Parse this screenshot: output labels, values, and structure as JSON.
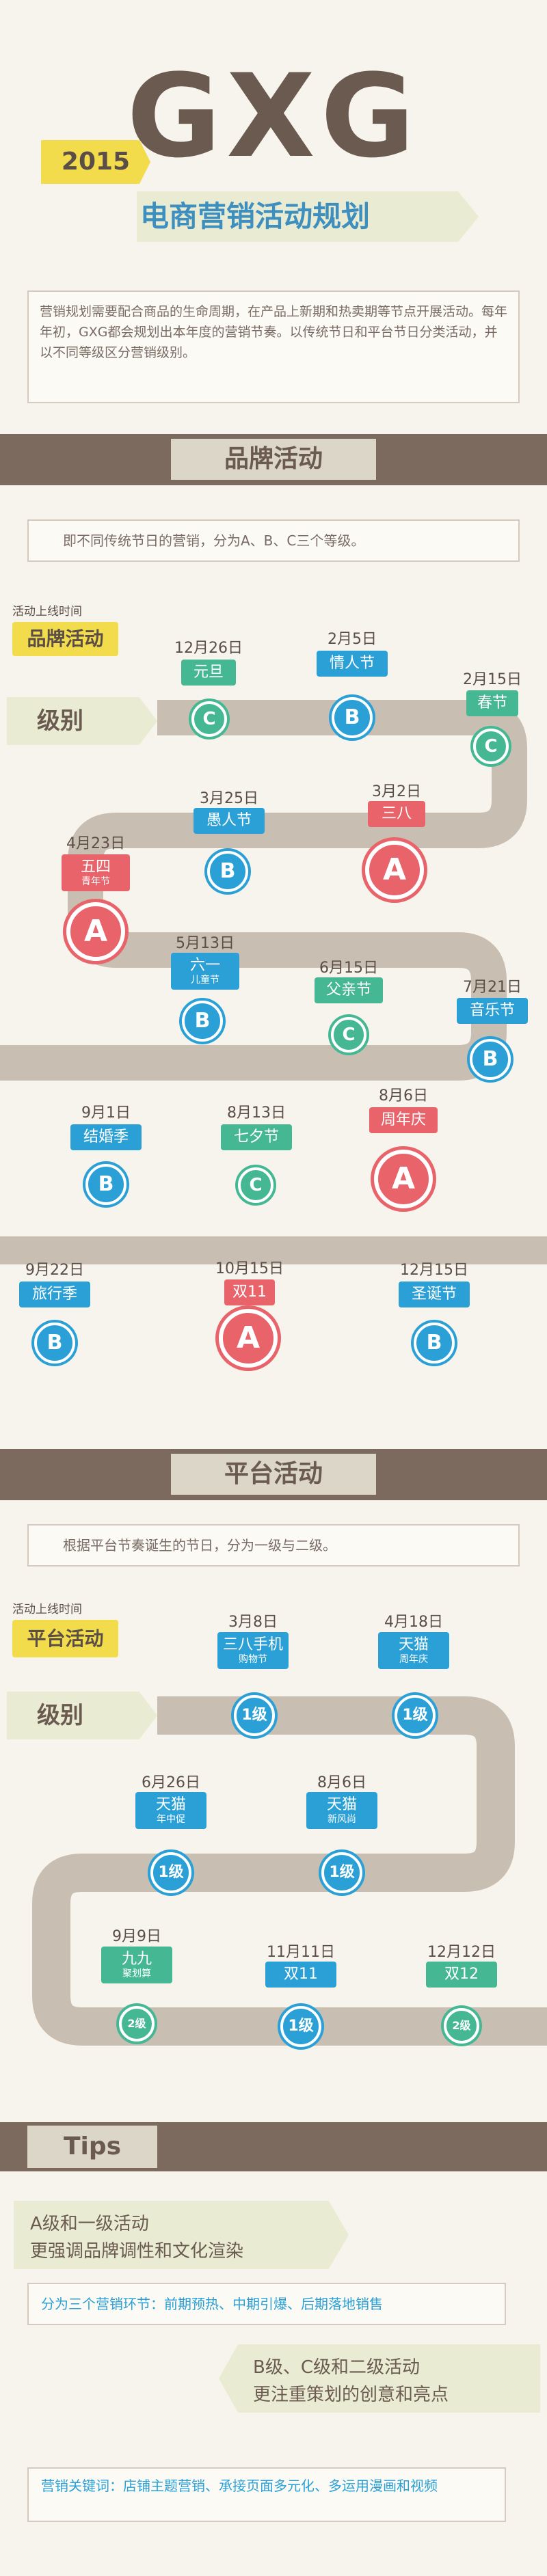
{
  "header": {
    "logo": "GXG",
    "year": "2015",
    "title": "电商营销活动规划",
    "intro": "营销规划需要配合商品的生命周期，在产品上新期和热卖期等节点开展活动。每年年初，GXG都会规划出本年度的营销节奏。以传统节日和平台节日分类活动，并以不同等级区分营销级别。"
  },
  "brand": {
    "section_title": "品牌活动",
    "note": "即不同传统节日的营销，分为A、B、C三个等级。",
    "online_time_label": "活动上线时间",
    "flag": "品牌活动",
    "level_label": "级别",
    "events": [
      {
        "date": "12月26日",
        "name": "元旦",
        "sub": "",
        "grade": "C",
        "color": "green"
      },
      {
        "date": "2月5日",
        "name": "情人节",
        "sub": "",
        "grade": "B",
        "color": "blue"
      },
      {
        "date": "2月15日",
        "name": "春节",
        "sub": "",
        "grade": "C",
        "color": "green"
      },
      {
        "date": "3月25日",
        "name": "愚人节",
        "sub": "",
        "grade": "B",
        "color": "blue"
      },
      {
        "date": "3月2日",
        "name": "三八",
        "sub": "",
        "grade": "A",
        "color": "red"
      },
      {
        "date": "4月23日",
        "name": "五四",
        "sub": "青年节",
        "grade": "A",
        "color": "red"
      },
      {
        "date": "5月13日",
        "name": "六一",
        "sub": "儿童节",
        "grade": "B",
        "color": "blue"
      },
      {
        "date": "6月15日",
        "name": "父亲节",
        "sub": "",
        "grade": "C",
        "color": "green"
      },
      {
        "date": "7月21日",
        "name": "音乐节",
        "sub": "",
        "grade": "B",
        "color": "blue"
      },
      {
        "date": "9月1日",
        "name": "结婚季",
        "sub": "",
        "grade": "B",
        "color": "blue"
      },
      {
        "date": "8月13日",
        "name": "七夕节",
        "sub": "",
        "grade": "C",
        "color": "green"
      },
      {
        "date": "8月6日",
        "name": "周年庆",
        "sub": "",
        "grade": "A",
        "color": "red"
      },
      {
        "date": "9月22日",
        "name": "旅行季",
        "sub": "",
        "grade": "B",
        "color": "blue"
      },
      {
        "date": "10月15日",
        "name": "双11",
        "sub": "",
        "grade": "A",
        "color": "red"
      },
      {
        "date": "12月15日",
        "name": "圣诞节",
        "sub": "",
        "grade": "B",
        "color": "blue"
      }
    ]
  },
  "platform": {
    "section_title": "平台活动",
    "note": "根据平台节奏诞生的节日，分为一级与二级。",
    "online_time_label": "活动上线时间",
    "flag": "平台活动",
    "level_label": "级别",
    "events": [
      {
        "date": "3月8日",
        "name": "三八手机",
        "sub": "购物节",
        "grade": "1级",
        "color": "blue"
      },
      {
        "date": "4月18日",
        "name": "天猫",
        "sub": "周年庆",
        "grade": "1级",
        "color": "blue"
      },
      {
        "date": "6月26日",
        "name": "天猫",
        "sub": "年中促",
        "grade": "1级",
        "color": "blue"
      },
      {
        "date": "8月6日",
        "name": "天猫",
        "sub": "新风尚",
        "grade": "1级",
        "color": "blue"
      },
      {
        "date": "9月9日",
        "name": "九九",
        "sub": "聚划算",
        "grade": "2级",
        "color": "green"
      },
      {
        "date": "11月11日",
        "name": "双11",
        "sub": "",
        "grade": "1级",
        "color": "blue"
      },
      {
        "date": "12月12日",
        "name": "双12",
        "sub": "",
        "grade": "2级",
        "color": "green"
      }
    ]
  },
  "tips": {
    "title": "Tips",
    "tip1": "A级和一级活动\n更强调品牌调性和文化渲染",
    "box1": "分为三个营销环节：前期预热、中期引爆、后期落地销售",
    "tip2": "B级、C级和二级活动\n更注重策划的创意和亮点",
    "box2": "营销关键词：店铺主题营销、承接页面多元化、多运用漫画和视频"
  },
  "colors": {
    "green": "#45b893",
    "blue": "#2aa0d7",
    "red": "#e8636a",
    "brown": "#7c6a5f",
    "yellow": "#f2dc4b"
  }
}
